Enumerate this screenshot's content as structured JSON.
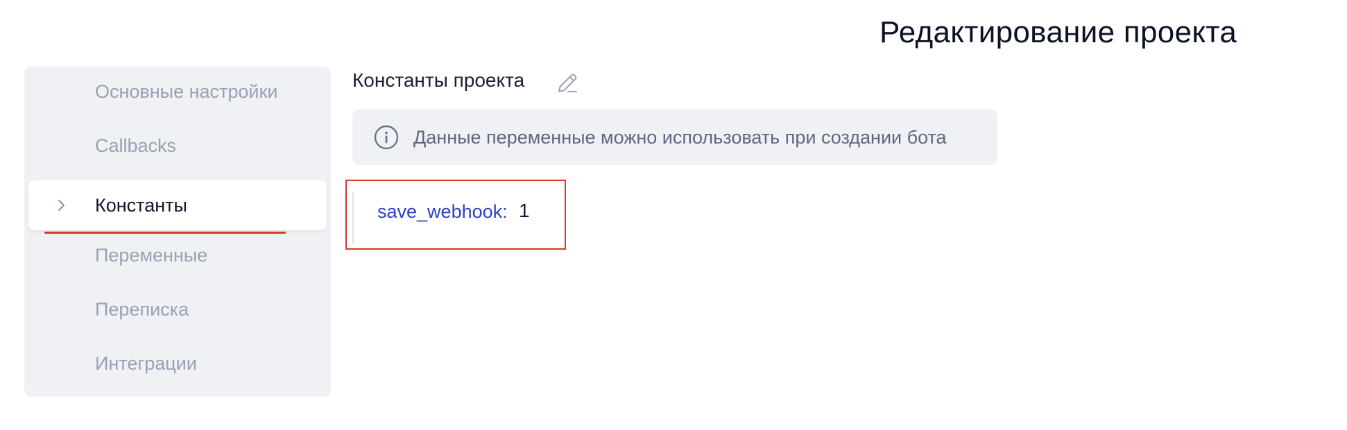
{
  "header": {
    "title": "Редактирование проекта"
  },
  "sidebar": {
    "items": [
      {
        "label": "Основные настройки",
        "active": false
      },
      {
        "label": "Callbacks",
        "active": false
      },
      {
        "label": "Константы",
        "active": true
      },
      {
        "label": "Переменные",
        "active": false
      },
      {
        "label": "Переписка",
        "active": false
      },
      {
        "label": "Интеграции",
        "active": false
      }
    ]
  },
  "main": {
    "section_title": "Константы проекта",
    "info_text": "Данные переменные можно использовать при создании бота",
    "constants": [
      {
        "key": "save_webhook:",
        "value": "1"
      }
    ]
  },
  "colors": {
    "sidebar_bg": "#eff1f5",
    "active_item_bg": "#ffffff",
    "muted_text": "#9aa1b3",
    "key_blue": "#2c43c9",
    "highlight_red": "#cf3b2f"
  },
  "icons": [
    "chevron-right-icon",
    "pencil-icon",
    "info-icon"
  ]
}
